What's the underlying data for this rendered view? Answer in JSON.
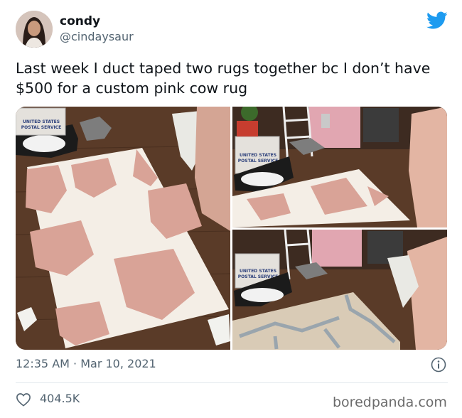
{
  "user": {
    "display_name": "condy",
    "handle": "@cindaysaur"
  },
  "icons": {
    "brand": "twitter-bird-icon",
    "info": "info-icon",
    "like": "heart-icon"
  },
  "tweet": {
    "text": "Last week I duct taped two rugs together bc I don’t have $500 for a custom pink cow rug",
    "timestamp": "12:35 AM · Mar 10, 2021",
    "likes": "404.5K"
  },
  "media": {
    "photos": [
      {
        "box_text_1": "UNITED STATES",
        "box_text_2": "POSTAL SERVICE"
      },
      {
        "box_text_1": "UNITED STATES",
        "box_text_2": "POSTAL SERVICE"
      },
      {
        "box_text_1": "UNITED STATES",
        "box_text_2": "POSTAL SERVICE"
      }
    ]
  },
  "watermark": "boredpanda.com",
  "colors": {
    "twitter_blue": "#1d9bf0",
    "secondary_text": "#536471",
    "rug_pink": "#d9a397",
    "rug_white": "#f4eee6",
    "floor": "#5e3f2b"
  }
}
